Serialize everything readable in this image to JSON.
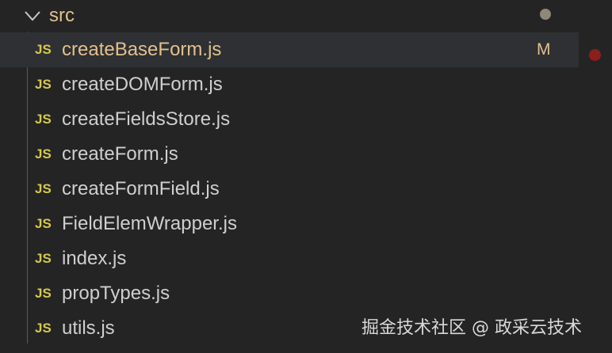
{
  "explorer": {
    "folder": {
      "label": "src",
      "icon": "chevron-down-icon",
      "status_dot_color": "#8f877a"
    },
    "files": [
      {
        "label": "createBaseForm.js",
        "icon_text": "JS",
        "badge": "M",
        "selected": true
      },
      {
        "label": "createDOMForm.js",
        "icon_text": "JS",
        "badge": ""
      },
      {
        "label": "createFieldsStore.js",
        "icon_text": "JS",
        "badge": ""
      },
      {
        "label": "createForm.js",
        "icon_text": "JS",
        "badge": ""
      },
      {
        "label": "createFormField.js",
        "icon_text": "JS",
        "badge": ""
      },
      {
        "label": "FieldElemWrapper.js",
        "icon_text": "JS",
        "badge": ""
      },
      {
        "label": "index.js",
        "icon_text": "JS",
        "badge": ""
      },
      {
        "label": "propTypes.js",
        "icon_text": "JS",
        "badge": ""
      },
      {
        "label": "utils.js",
        "icon_text": "JS",
        "badge": ""
      }
    ],
    "colors": {
      "background": "#242424",
      "selected_row": "#2e3033",
      "modified_text": "#e2c08d",
      "js_icon": "#d6c84f",
      "gutter_marker": "#8a1f1c"
    }
  },
  "watermark": {
    "text": "掘金技术社区 @ 政采云技术"
  }
}
